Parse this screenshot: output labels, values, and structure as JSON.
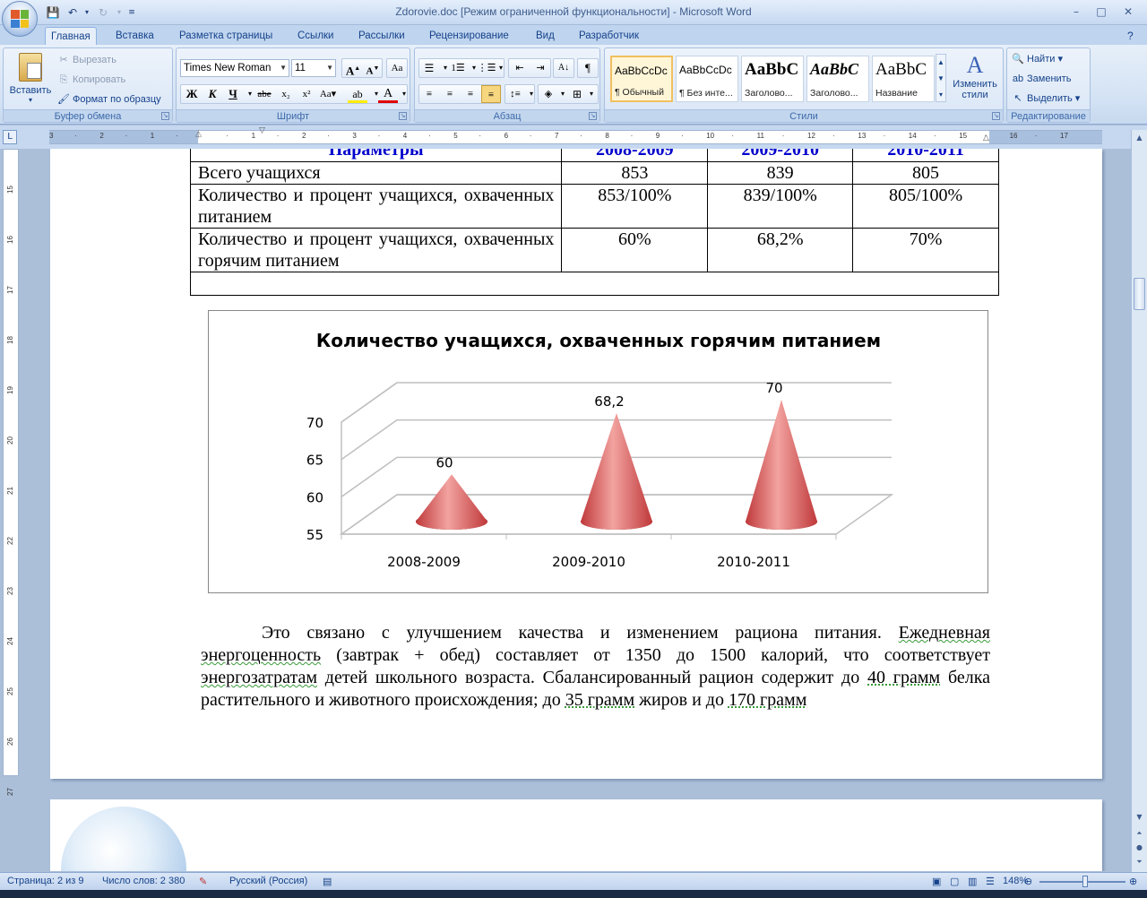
{
  "window": {
    "title": "Zdorovie.doc [Режим ограниченной функциональности] - Microsoft Word",
    "minimize": "–",
    "maximize": "□",
    "close": "✕"
  },
  "tabs": [
    "Главная",
    "Вставка",
    "Разметка страницы",
    "Ссылки",
    "Рассылки",
    "Рецензирование",
    "Вид",
    "Разработчик"
  ],
  "ribbon": {
    "clipboard": {
      "label": "Буфер обмена",
      "paste": "Вставить",
      "cut": "Вырезать",
      "copy": "Копировать",
      "format_painter": "Формат по образцу"
    },
    "font": {
      "label": "Шрифт",
      "font_name": "Times New Roman",
      "font_size": "11"
    },
    "paragraph": {
      "label": "Абзац"
    },
    "styles": {
      "label": "Стили",
      "items": [
        {
          "sample": "AaBbCcDc",
          "name": "¶ Обычный"
        },
        {
          "sample": "AaBbCcDc",
          "name": "¶ Без инте..."
        },
        {
          "sample": "AaBbC",
          "name": "Заголово..."
        },
        {
          "sample": "AaBbC",
          "name": "Заголово..."
        },
        {
          "sample": "AaBbC",
          "name": "Название"
        }
      ],
      "change_styles": "Изменить стили"
    },
    "editing": {
      "label": "Редактирование",
      "find": "Найти",
      "replace": "Заменить",
      "select": "Выделить"
    }
  },
  "table": {
    "headers": [
      "Параметры",
      "2008-2009",
      "2009-2010",
      "2010-2011"
    ],
    "rows": [
      {
        "label": "Всего учащихся",
        "values": [
          "853",
          "839",
          "805"
        ]
      },
      {
        "label": "Количество и процент учащихся, охваченных питанием",
        "values": [
          "853/100%",
          "839/100%",
          "805/100%"
        ]
      },
      {
        "label": "Количество и процент учащихся, охваченных горячим питанием",
        "values": [
          "60%",
          "68,2%",
          "70%"
        ]
      }
    ]
  },
  "chart_data": {
    "type": "bar",
    "style": "3d-cone",
    "title": "Количество учащихся, охваченных горячим питанием",
    "categories": [
      "2008-2009",
      "2009-2010",
      "2010-2011"
    ],
    "values": [
      60,
      68.2,
      70
    ],
    "value_labels": [
      "60",
      "68,2",
      "70"
    ],
    "ylim": [
      55,
      70
    ],
    "yticks": [
      55,
      60,
      65,
      70
    ],
    "grid": true,
    "legend": "none",
    "colors": {
      "cone": "#c0393b",
      "cone_light": "#f2a3a0"
    }
  },
  "paragraph": {
    "s1": "Это связано с улучшением качества и изменением рациона питания.",
    "s2a": "Ежедневная",
    "s2b": "энергоценность",
    "s2c": "(завтрак + обед) составляет от 1350 до 1500 калорий, что соответствует",
    "s2d": "энергозатратам",
    "s2e": "детей школьного возраста. Сбалансированный рацион содержит до",
    "s2f": "40 грамм",
    "s2g": "белка растительного и животного происхождения; до",
    "s2h": "35 грамм",
    "s2i": "жиров и до",
    "s2j": "170 грамм"
  },
  "statusbar": {
    "page": "Страница: 2 из 9",
    "words": "Число слов: 2 380",
    "language": "Русский (Россия)",
    "zoom": "148%"
  }
}
